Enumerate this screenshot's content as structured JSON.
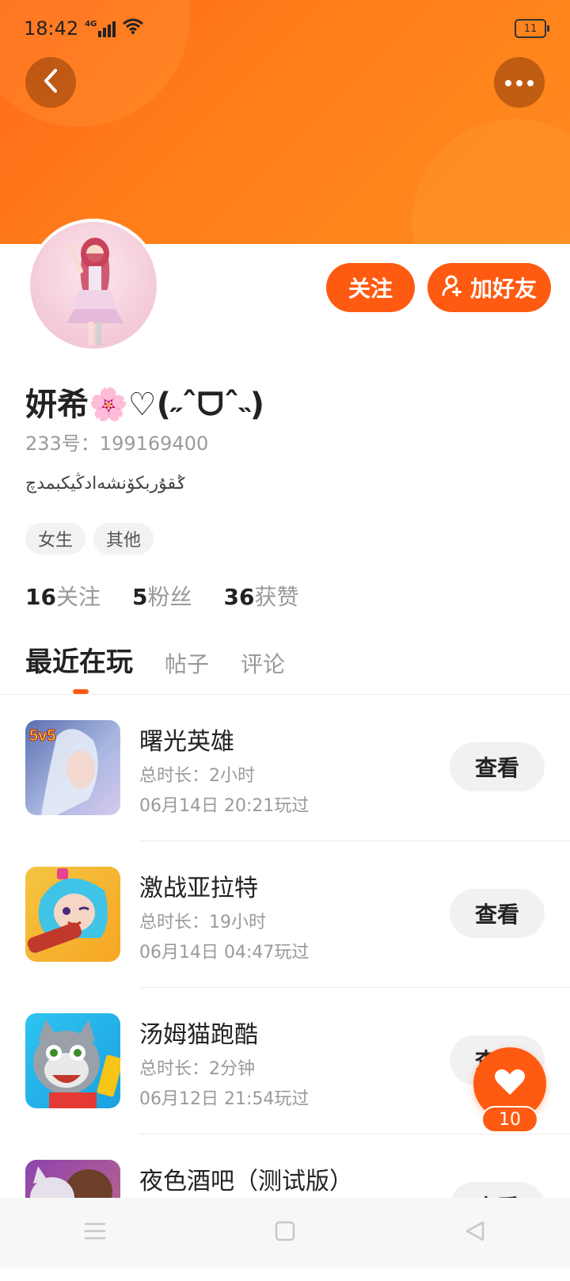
{
  "status_bar": {
    "time": "18:42",
    "network": "4G",
    "battery": "11"
  },
  "header": {
    "back_icon": "chevron-left-icon",
    "more_icon": "more-dots-icon"
  },
  "actions": {
    "follow_label": "关注",
    "add_friend_label": "加好友"
  },
  "profile": {
    "name": "妍希🌸♡(˶ˆᗜˆ˵)",
    "id_text": "233号：199169400",
    "bio": "ݣقۇربكۆنشەادڭيكبمدچ",
    "tags": [
      "女生",
      "其他"
    ]
  },
  "stats": [
    {
      "num": "16",
      "label": "关注"
    },
    {
      "num": "5",
      "label": "粉丝"
    },
    {
      "num": "36",
      "label": "获赞"
    }
  ],
  "tabs": [
    "最近在玩",
    "帖子",
    "评论"
  ],
  "games": [
    {
      "name": "曙光英雄",
      "duration": "总时长：2小时",
      "last_played": "06月14日 20:21玩过",
      "button": "查看",
      "badge": "5v5"
    },
    {
      "name": "激战亚拉特",
      "duration": "总时长：19小时",
      "last_played": "06月14日 04:47玩过",
      "button": "查看"
    },
    {
      "name": "汤姆猫跑酷",
      "duration": "总时长：2分钟",
      "last_played": "06月12日 21:54玩过",
      "button": "查看"
    },
    {
      "name": "夜色酒吧（测试版）",
      "button": "查看"
    }
  ],
  "fab": {
    "icon": "heart-icon",
    "count": "10"
  },
  "colors": {
    "accent": "#ff5a12",
    "header_start": "#ff6a1a",
    "header_end": "#ff8a1f"
  }
}
